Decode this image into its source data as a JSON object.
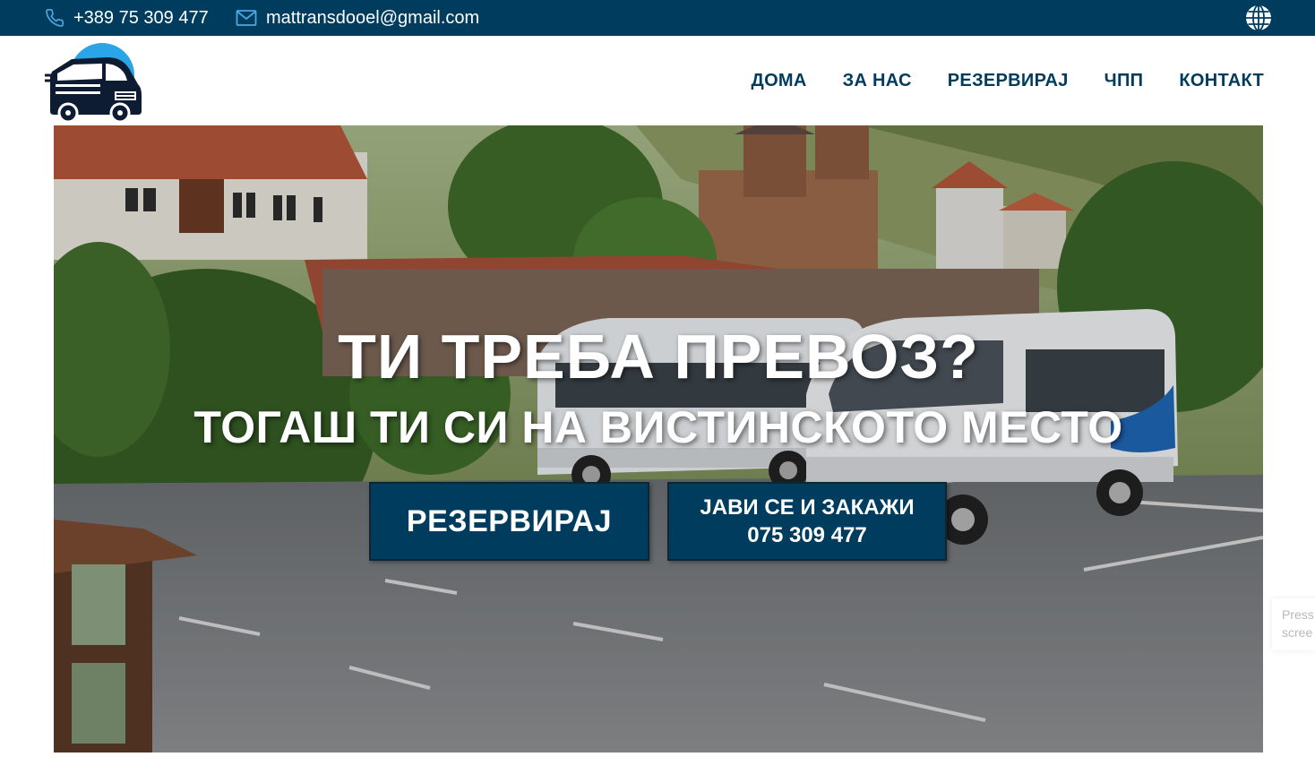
{
  "topbar": {
    "phone": "+389 75 309 477",
    "email": "mattransdooel@gmail.com",
    "phone_icon": "phone-icon",
    "email_icon": "envelope-icon",
    "language_icon": "globe-icon"
  },
  "header": {
    "logo": "van-logo",
    "nav": [
      {
        "label": "ДОМА"
      },
      {
        "label": "ЗА НАС"
      },
      {
        "label": "РЕЗЕРВИРАЈ"
      },
      {
        "label": "ЧПП"
      },
      {
        "label": "КОНТАКТ"
      }
    ]
  },
  "hero": {
    "headline": "ТИ ТРЕБА ПРЕВОЗ?",
    "subheadline": "ТОГАШ ТИ СИ НА ВИСТИНСКОТО МЕСТО",
    "reserve_button": "РЕЗЕРВИРАЈ",
    "call_button_line1": "ЈАВИ СЕ И ЗАКАЖИ",
    "call_button_line2": "075 309 477"
  },
  "side_widget": {
    "line1": "Press",
    "line2": "scree"
  },
  "colors": {
    "brand": "#003c5e",
    "accent": "#2aa6e8",
    "text_light": "#ffffff"
  }
}
